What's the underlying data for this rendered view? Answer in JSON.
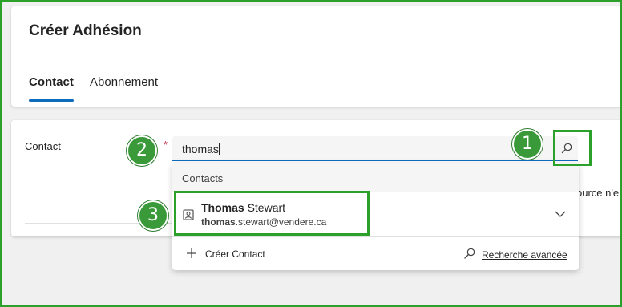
{
  "page": {
    "title": "Créer Adhésion"
  },
  "tabs": [
    {
      "label": "Contact",
      "active": true
    },
    {
      "label": "Abonnement",
      "active": false
    }
  ],
  "form": {
    "contact_label": "Contact",
    "required_marker": "*",
    "search_value": "thomas",
    "clipped_text": "ource n'e"
  },
  "dropdown": {
    "section_label": "Contacts",
    "result": {
      "name_match": "Thomas",
      "name_rest": " Stewart",
      "email_match": "thomas",
      "email_rest": ".stewart@vendere.ca"
    },
    "create_label": "Créer Contact",
    "advanced_label": "Recherche avancée"
  },
  "annotations": {
    "badge_1": "1",
    "badge_2": "2",
    "badge_3": "3",
    "color": "#2ba02b"
  },
  "icons": [
    "search-icon",
    "contact-card-icon",
    "chevron-down-icon",
    "plus-icon",
    "advanced-search-icon"
  ]
}
